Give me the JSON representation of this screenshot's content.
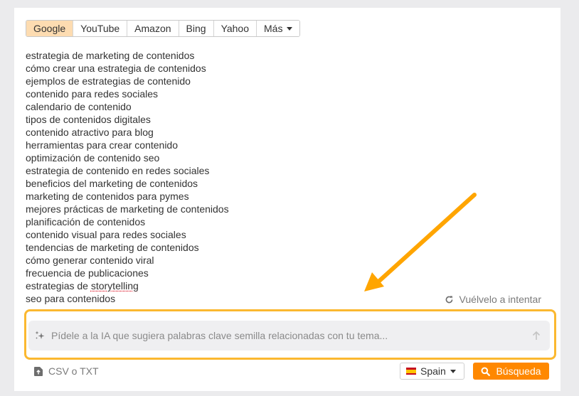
{
  "engine_tabs": [
    {
      "label": "Google",
      "active": true
    },
    {
      "label": "YouTube",
      "active": false
    },
    {
      "label": "Amazon",
      "active": false
    },
    {
      "label": "Bing",
      "active": false
    },
    {
      "label": "Yahoo",
      "active": false
    },
    {
      "label": "Más",
      "active": false,
      "dropdown": true
    }
  ],
  "keywords": [
    "estrategia de marketing de contenidos",
    "cómo crear una estrategia de contenidos",
    "ejemplos de estrategias de contenido",
    "contenido para redes sociales",
    "calendario de contenido",
    "tipos de contenidos digitales",
    "contenido atractivo para blog",
    "herramientas para crear contenido",
    "optimización de contenido seo",
    "estrategia de contenido en redes sociales",
    "beneficios del marketing de contenidos",
    "marketing de contenidos para pymes",
    "mejores prácticas de marketing de contenidos",
    "planificación de contenidos",
    "contenido visual para redes sociales",
    "tendencias de marketing de contenidos",
    "cómo generar contenido viral",
    "frecuencia de publicaciones",
    "estrategias de storytelling",
    "seo para contenidos"
  ],
  "keyword_spellcheck": {
    "prefix": "estrategias de ",
    "flagged_word": "storytelling"
  },
  "retry_label": "Vuélvelo a intentar",
  "ai_input": {
    "placeholder": "Pídele a la IA que sugiera palabras clave semilla relacionadas con tu tema...",
    "value": ""
  },
  "upload_label": "CSV o TXT",
  "country": {
    "label": "Spain",
    "flag": "es"
  },
  "search_button": "Búsqueda",
  "colors": {
    "accent_orange": "#ff8800",
    "highlight_frame": "#fbb830",
    "active_tab": "#fddcb1",
    "annotation_arrow": "#ffa500"
  },
  "icons": {
    "retry": "refresh-icon",
    "ai": "sparkle-icon",
    "send": "arrow-up-icon",
    "upload": "file-upload-icon",
    "search": "magnifier-icon",
    "dropdown": "caret-down-icon"
  }
}
